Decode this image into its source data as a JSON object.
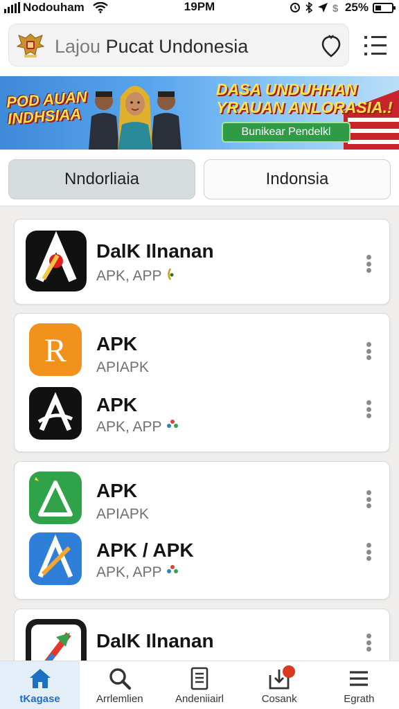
{
  "status_bar": {
    "carrier": "Nodouham",
    "time": "19PM",
    "battery": "25%"
  },
  "header": {
    "title_prefix": "Lajou",
    "title_main": "Pucat Undonesia"
  },
  "banner": {
    "left_text_line1": "POD AUAN",
    "left_text_line2": "INDHSIAA",
    "right_text_line1": "DASA UNDUHHAN",
    "right_text_line2": "YRAUAN ANLORASIA.!",
    "button_label": "Bunikear Pendelkl"
  },
  "tabs": [
    {
      "label": "Nndorliaia",
      "selected": true
    },
    {
      "label": "Indonsia",
      "selected": false
    }
  ],
  "apps": [
    {
      "name": "DalK Ilnanan",
      "subtitle": "APK, APP",
      "icon": "red-a-logo-icon"
    },
    {
      "name": "APK",
      "subtitle": "APIAPK",
      "icon": "orange-r-logo-icon"
    },
    {
      "name": "APK",
      "subtitle": "APK, APP",
      "icon": "black-a-logo-icon"
    },
    {
      "name": "APK",
      "subtitle": "APIAPK",
      "icon": "green-a-logo-icon"
    },
    {
      "name": "APK / APK",
      "subtitle": "APK, APP",
      "icon": "blue-a-logo-icon"
    },
    {
      "name": "DalK Ilnanan",
      "subtitle": "",
      "icon": "rocket-logo-icon"
    }
  ],
  "bottom_nav": [
    {
      "label": "tKagase",
      "icon": "home-icon",
      "active": true
    },
    {
      "label": "Arrlemlien",
      "icon": "search-icon",
      "active": false
    },
    {
      "label": "Andeniiairl",
      "icon": "document-icon",
      "active": false
    },
    {
      "label": "Cosank",
      "icon": "download-icon",
      "active": false
    },
    {
      "label": "Egrath",
      "icon": "menu-icon",
      "active": false
    }
  ],
  "colors": {
    "accent": "#1d6fc4",
    "banner_button": "#2f9b47",
    "badge": "#d9391f"
  }
}
